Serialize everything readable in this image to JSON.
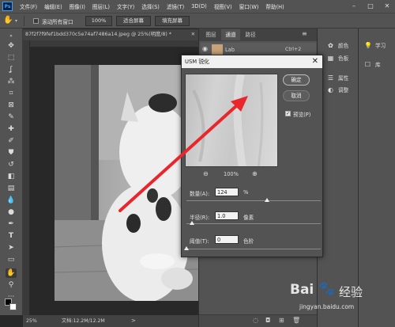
{
  "menu": {
    "logo": "Ps",
    "items": [
      "文件(F)",
      "编辑(E)",
      "图像(I)",
      "图层(L)",
      "文字(Y)",
      "选择(S)",
      "滤镜(T)",
      "3D(D)",
      "视图(V)",
      "窗口(W)",
      "帮助(H)"
    ],
    "window_buttons": [
      "–",
      "□",
      "✕"
    ]
  },
  "options_bar": {
    "scroll_all_label": "滚动所有窗口",
    "zoom_btn": "100%",
    "fit_btn": "适合屏幕",
    "fill_btn": "填充屏幕"
  },
  "document": {
    "tab_title": "87f2f7f9fef1bdd370c5e74af7486a14.jpeg @ 25%(明度/8) *",
    "close": "✕",
    "zoom": "25%",
    "doc_info": "文档:12.2M/12.2M"
  },
  "layers_panel": {
    "tabs": [
      "图层",
      "通道",
      "路径"
    ],
    "channel_row": {
      "name": "Lab",
      "shortcut": "Ctrl+2"
    }
  },
  "right_dock": {
    "items": [
      {
        "icon": "palette-icon",
        "label": "颜色"
      },
      {
        "icon": "swatches-icon",
        "label": "色板"
      },
      {
        "icon": "properties-icon",
        "label": "属性"
      },
      {
        "icon": "adjustments-icon",
        "label": "调整"
      }
    ],
    "items2": [
      {
        "icon": "learn-icon",
        "label": "学习"
      },
      {
        "icon": "library-icon",
        "label": "库"
      }
    ]
  },
  "dialog": {
    "title": "USM 锐化",
    "close": "✕",
    "ok": "确定",
    "cancel": "取消",
    "preview_label": "预览(P)",
    "preview_checked": true,
    "zoom_out": "⊖",
    "zoom_level": "100%",
    "zoom_in": "⊕",
    "amount": {
      "label": "数量(A):",
      "value": "124",
      "unit": "%",
      "slider": 0.6
    },
    "radius": {
      "label": "半径(R):",
      "value": "1.0",
      "unit": "像素",
      "slider": 0.04
    },
    "threshold": {
      "label": "阈值(T):",
      "value": "0",
      "unit": "色阶",
      "slider": 0.0
    }
  },
  "watermark": {
    "brand": "Bai",
    "brand2": "经验",
    "url": "jingyan.baidu.com"
  },
  "colors": {
    "arrow": "#e8262c",
    "accent": "#31a8ff"
  }
}
